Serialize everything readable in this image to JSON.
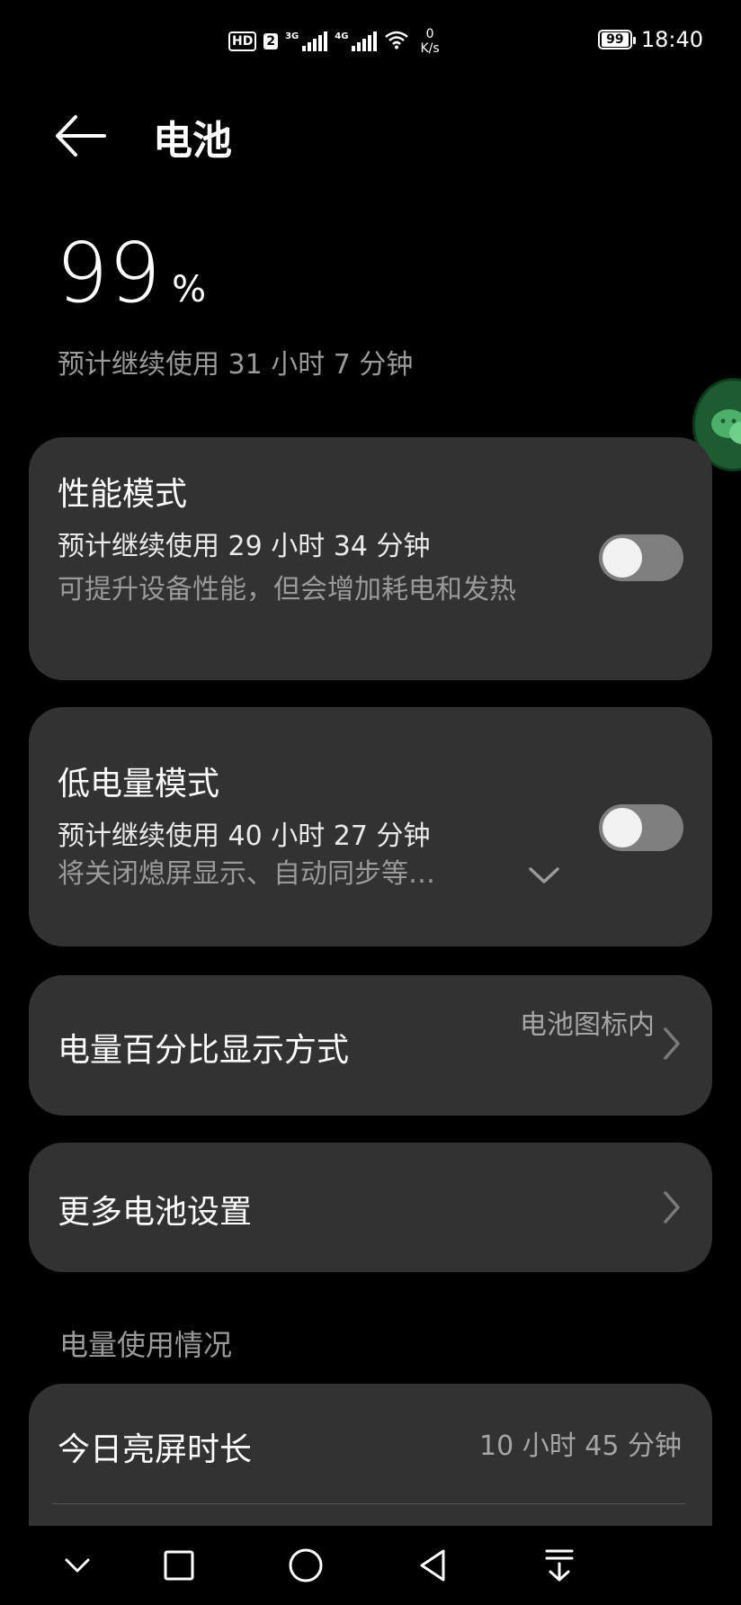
{
  "status_bar": {
    "hd_badge": "HD",
    "sim_number": "2",
    "network_1": "3G",
    "network_2": "4G",
    "speed_value": "0",
    "speed_unit": "K/s",
    "battery_level": "99",
    "time": "18:40"
  },
  "header": {
    "title": "电池",
    "back_icon": "arrow-left-icon"
  },
  "battery": {
    "percent": "99",
    "percent_sign": "%",
    "estimate": "预计继续使用 31 小时 7 分钟"
  },
  "floating_button": {
    "icon": "wechat-icon",
    "color": "#1c5c30"
  },
  "performance_mode": {
    "title": "性能模式",
    "estimate": "预计继续使用 29 小时 34 分钟",
    "description": "可提升设备性能，但会增加耗电和发热",
    "enabled": false
  },
  "low_power_mode": {
    "title": "低电量模式",
    "estimate": "预计继续使用 40 小时 27 分钟",
    "description": "将关闭熄屏显示、自动同步等…",
    "enabled": false
  },
  "percentage_display": {
    "label": "电量百分比显示方式",
    "value": "电池图标内"
  },
  "more_settings": {
    "label": "更多电池设置"
  },
  "usage": {
    "section_label": "电量使用情况",
    "screen_time_label": "今日亮屏时长",
    "screen_time_value": "10 小时 45 分钟"
  },
  "colors": {
    "background": "#000000",
    "card": "#323232",
    "secondary_text": "#9a9a9a",
    "toggle_off": "#7f7f7f"
  }
}
